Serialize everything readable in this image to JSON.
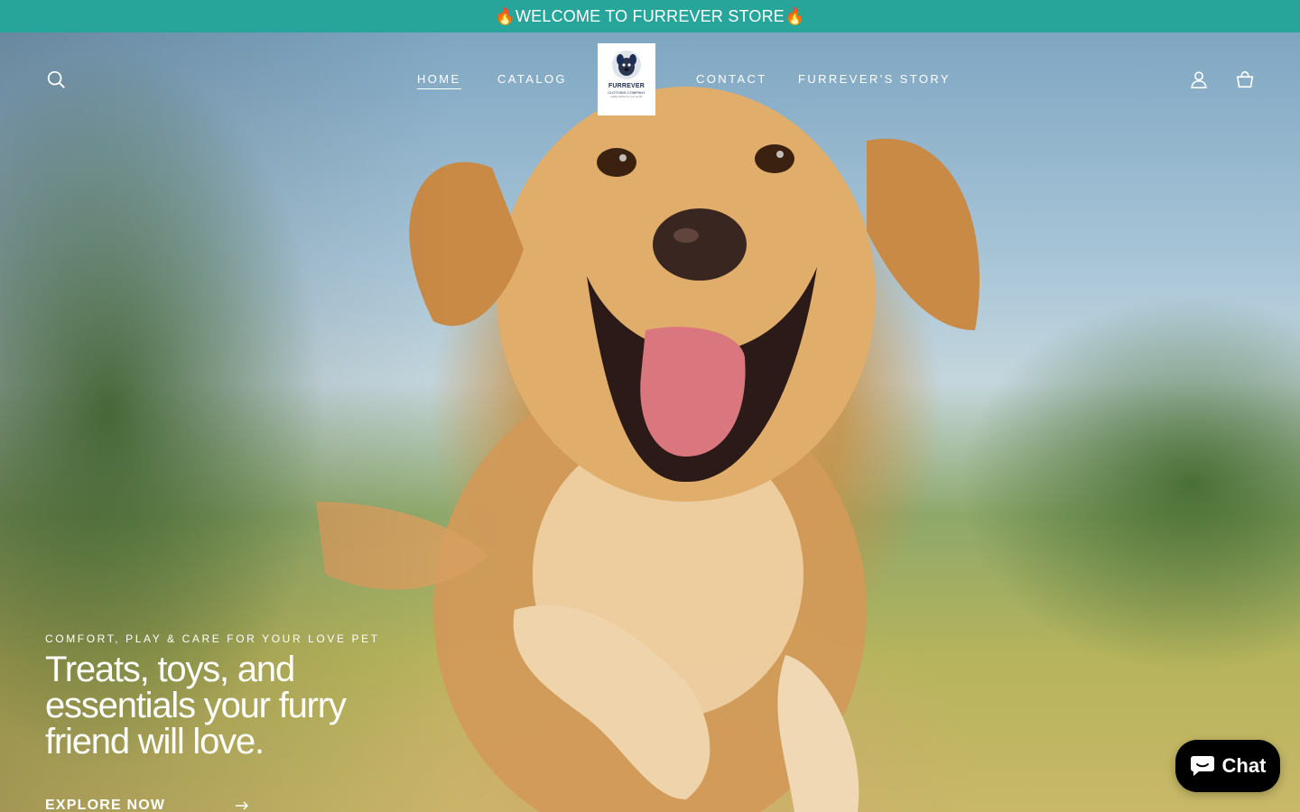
{
  "announcement": {
    "text": "🔥WELCOME TO FURREVER STORE🔥",
    "background_color": "#27a59a"
  },
  "header": {
    "search_icon": "search-icon",
    "account_icon": "user-icon",
    "cart_icon": "shopping-bag-icon",
    "nav": [
      {
        "label": "HOME",
        "active": true
      },
      {
        "label": "CATALOG",
        "active": false
      },
      {
        "label": "CONTACT",
        "active": false
      },
      {
        "label": "FURREVER'S STORY",
        "active": false
      }
    ],
    "logo": {
      "brand": "FURREVER",
      "sub": "CLOTHING COMPANY",
      "tagline": "quality clothing for your pet life"
    }
  },
  "hero": {
    "eyebrow": "COMFORT, PLAY & CARE FOR YOUR LOVE PET",
    "headline": "Treats, toys, and essentials your furry friend will love.",
    "cta_label": "EXPLORE NOW",
    "cta_icon": "arrow-right-icon"
  },
  "chat": {
    "label": "Chat",
    "icon": "chat-bubble-icon"
  }
}
